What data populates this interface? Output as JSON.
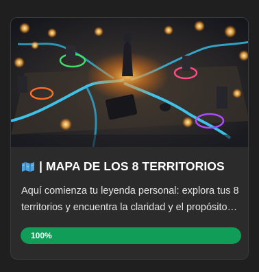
{
  "card": {
    "image_alt": "fantasy territory map artwork",
    "title": "| MAPA DE LOS 8 TERRITORIOS",
    "title_icon": "map-icon",
    "description": "Aquí comienza tu leyenda personal: explora tus 8 territorios y encuentra la claridad y el propósito que buscas.",
    "progress": {
      "value_percent": 100,
      "label": "100%",
      "color": "#0f9d58"
    }
  }
}
